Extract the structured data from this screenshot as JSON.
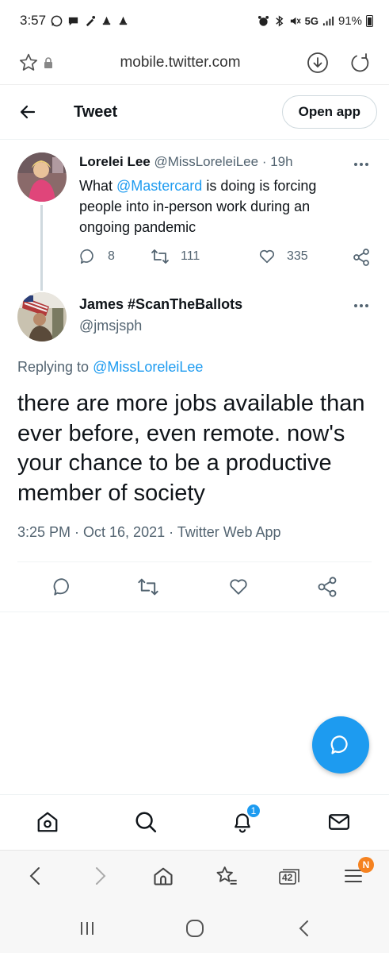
{
  "status_bar": {
    "time": "3:57",
    "network": "5G",
    "battery": "91%"
  },
  "browser": {
    "url": "mobile.twitter.com",
    "tab_count": "42",
    "menu_badge": "N"
  },
  "header": {
    "title": "Tweet",
    "open_app_label": "Open app"
  },
  "parent_tweet": {
    "name": "Lorelei Lee",
    "handle": "@MissLoreleiLee",
    "time": "· 19h",
    "text_prefix": "What ",
    "mention": "@Mastercard",
    "text_suffix": " is doing is forcing people into in-person work during an ongoing pandemic",
    "replies": "8",
    "retweets": "111",
    "likes": "335"
  },
  "reply_tweet": {
    "name": "James #ScanTheBallots",
    "handle": "@jmsjsph",
    "replying_prefix": "Replying to ",
    "replying_to": "@MissLoreleiLee",
    "text": "there are more jobs available than ever before, even remote. now's your chance to be a productive member of society",
    "timestamp": "3:25 PM · Oct 16, 2021 · Twitter Web App"
  },
  "bottom_nav": {
    "notification_count": "1"
  },
  "colors": {
    "accent": "#1d9bf0",
    "text": "#0f1419",
    "secondary": "#536471",
    "menu_badge": "#f58220"
  }
}
